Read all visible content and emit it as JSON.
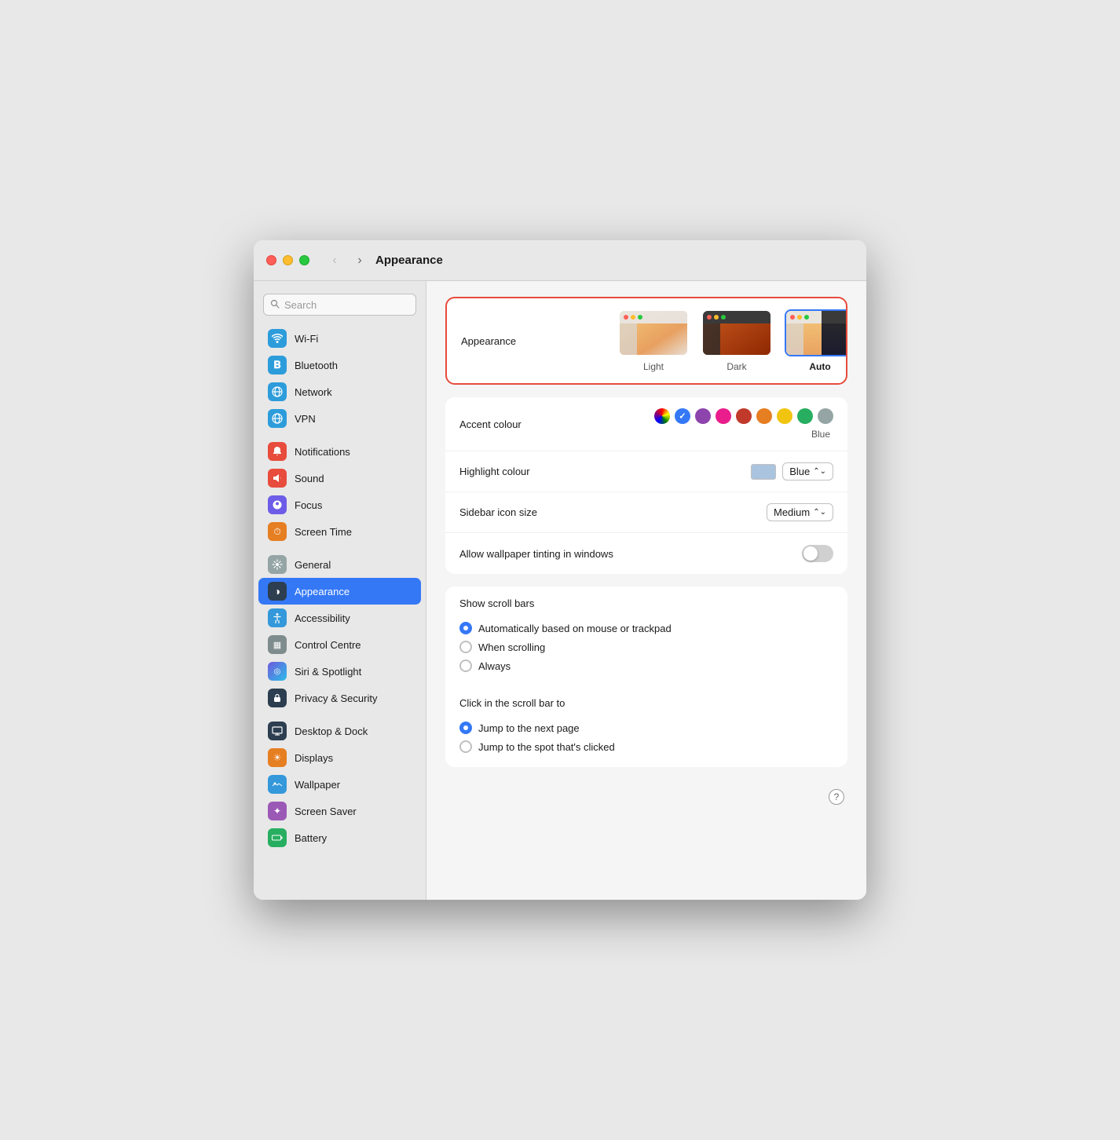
{
  "window": {
    "title": "Appearance"
  },
  "titlebar": {
    "back_arrow": "‹",
    "forward_arrow": "›",
    "title": "Appearance"
  },
  "sidebar": {
    "search_placeholder": "Search",
    "items": [
      {
        "id": "wifi",
        "label": "Wi-Fi",
        "icon": "wifi",
        "icon_char": "📶",
        "active": false
      },
      {
        "id": "bluetooth",
        "label": "Bluetooth",
        "icon": "bluetooth",
        "icon_char": "𝐁",
        "active": false
      },
      {
        "id": "network",
        "label": "Network",
        "icon": "network",
        "icon_char": "🌐",
        "active": false
      },
      {
        "id": "vpn",
        "label": "VPN",
        "icon": "vpn",
        "icon_char": "🌐",
        "active": false
      },
      {
        "id": "notifications",
        "label": "Notifications",
        "icon": "notifications",
        "icon_char": "🔔",
        "active": false
      },
      {
        "id": "sound",
        "label": "Sound",
        "icon": "sound",
        "icon_char": "🔊",
        "active": false
      },
      {
        "id": "focus",
        "label": "Focus",
        "icon": "focus",
        "icon_char": "🌙",
        "active": false
      },
      {
        "id": "screentime",
        "label": "Screen Time",
        "icon": "screentime",
        "icon_char": "⏱",
        "active": false
      },
      {
        "id": "general",
        "label": "General",
        "icon": "general",
        "icon_char": "⚙",
        "active": false
      },
      {
        "id": "appearance",
        "label": "Appearance",
        "icon": "appearance",
        "icon_char": "◑",
        "active": true
      },
      {
        "id": "accessibility",
        "label": "Accessibility",
        "icon": "accessibility",
        "icon_char": "♿",
        "active": false
      },
      {
        "id": "controlcentre",
        "label": "Control Centre",
        "icon": "controlcentre",
        "icon_char": "▦",
        "active": false
      },
      {
        "id": "siri",
        "label": "Siri & Spotlight",
        "icon": "siri",
        "icon_char": "◎",
        "active": false
      },
      {
        "id": "privacy",
        "label": "Privacy & Security",
        "icon": "privacy",
        "icon_char": "🔒",
        "active": false
      },
      {
        "id": "desktop",
        "label": "Desktop & Dock",
        "icon": "desktop",
        "icon_char": "🖥",
        "active": false
      },
      {
        "id": "displays",
        "label": "Displays",
        "icon": "displays",
        "icon_char": "☀",
        "active": false
      },
      {
        "id": "wallpaper",
        "label": "Wallpaper",
        "icon": "wallpaper",
        "icon_char": "🖼",
        "active": false
      },
      {
        "id": "screensaver",
        "label": "Screen Saver",
        "icon": "screensaver",
        "icon_char": "✦",
        "active": false
      },
      {
        "id": "battery",
        "label": "Battery",
        "icon": "battery",
        "icon_char": "🔋",
        "active": false
      }
    ]
  },
  "main": {
    "appearance_section_label": "Appearance",
    "appearance_options": [
      {
        "id": "light",
        "label": "Light",
        "selected": false
      },
      {
        "id": "dark",
        "label": "Dark",
        "selected": false
      },
      {
        "id": "auto",
        "label": "Auto",
        "selected": true
      }
    ],
    "accent_colour_label": "Accent colour",
    "accent_colours": [
      {
        "id": "multicolor",
        "color": "#b8a4c8",
        "label": "Multicolor"
      },
      {
        "id": "blue",
        "color": "#3478f6",
        "label": "Blue",
        "selected": true
      },
      {
        "id": "purple",
        "color": "#8e44ad",
        "label": "Purple"
      },
      {
        "id": "pink",
        "color": "#e91e8c",
        "label": "Pink"
      },
      {
        "id": "red",
        "color": "#c0392b",
        "label": "Red"
      },
      {
        "id": "orange",
        "color": "#e67e22",
        "label": "Orange"
      },
      {
        "id": "yellow",
        "color": "#f1c40f",
        "label": "Yellow"
      },
      {
        "id": "green",
        "color": "#27ae60",
        "label": "Green"
      },
      {
        "id": "graphite",
        "color": "#95a5a6",
        "label": "Graphite"
      }
    ],
    "accent_selected_label": "Blue",
    "highlight_colour_label": "Highlight colour",
    "highlight_colour_value": "Blue",
    "highlight_swatch_color": "#aac4e0",
    "sidebar_icon_size_label": "Sidebar icon size",
    "sidebar_icon_size_value": "Medium",
    "wallpaper_tinting_label": "Allow wallpaper tinting in windows",
    "wallpaper_tinting_enabled": false,
    "scroll_bars_section_label": "Show scroll bars",
    "scroll_bars_options": [
      {
        "id": "auto",
        "label": "Automatically based on mouse or trackpad",
        "selected": true
      },
      {
        "id": "scrolling",
        "label": "When scrolling",
        "selected": false
      },
      {
        "id": "always",
        "label": "Always",
        "selected": false
      }
    ],
    "click_scroll_section_label": "Click in the scroll bar to",
    "click_scroll_options": [
      {
        "id": "next_page",
        "label": "Jump to the next page",
        "selected": true
      },
      {
        "id": "spot_clicked",
        "label": "Jump to the spot that's clicked",
        "selected": false
      }
    ],
    "help_button_label": "?"
  }
}
